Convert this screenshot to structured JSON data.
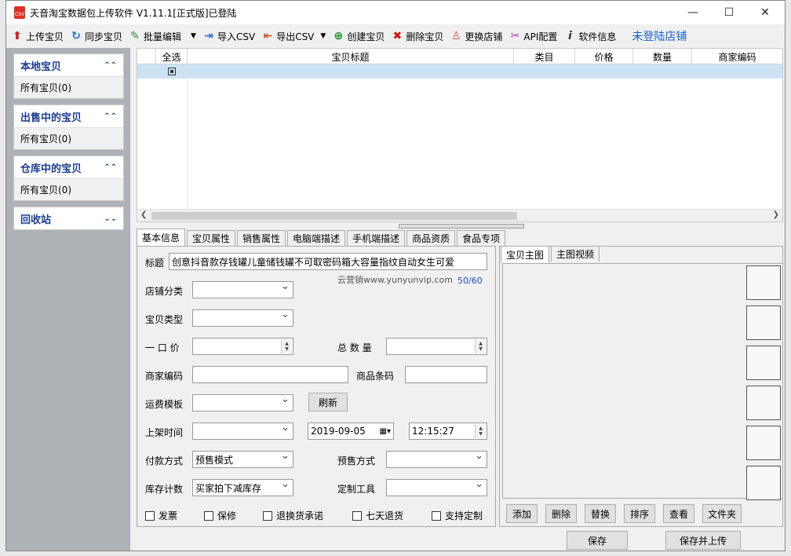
{
  "window": {
    "title": "天音淘宝数据包上传软件 V1.11.1[正式版]已登陆",
    "icon_text": "CSV",
    "min": "—",
    "max": "☐",
    "close": "✕"
  },
  "toolbar": {
    "upload": "上传宝贝",
    "sync": "同步宝贝",
    "batch_edit": "批量编辑",
    "import_csv": "导入CSV",
    "export_csv": "导出CSV",
    "create": "创建宝贝",
    "delete": "删除宝贝",
    "change_shop": "更换店铺",
    "api_config": "API配置",
    "software_info": "软件信息",
    "login_status": "未登陆店铺"
  },
  "sidebar": {
    "groups": [
      {
        "title": "本地宝贝",
        "item": "所有宝贝(0)"
      },
      {
        "title": "出售中的宝贝",
        "item": "所有宝贝(0)"
      },
      {
        "title": "仓库中的宝贝",
        "item": "所有宝贝(0)"
      },
      {
        "title": "回收站",
        "item": ""
      }
    ]
  },
  "grid": {
    "columns": [
      "全选",
      "宝贝标题",
      "类目",
      "价格",
      "数量",
      "商家编码"
    ]
  },
  "tabs": [
    "基本信息",
    "宝贝属性",
    "销售属性",
    "电脑端描述",
    "手机端描述",
    "商品资质",
    "食品专项"
  ],
  "form": {
    "title_label": "标题",
    "title_value": "创意抖音款存钱罐儿童储钱罐不可取密码箱大容量指纹自动女生可爱",
    "watermark": "云营销www.yunyunvip.com",
    "char_count": "50/60",
    "shop_category": "店铺分类",
    "item_type": "宝贝类型",
    "price": "一 口 价",
    "total_qty": "总 数 量",
    "merchant_code": "商家编码",
    "barcode": "商品条码",
    "freight": "运费模板",
    "refresh": "刷新",
    "list_time": "上架时间",
    "date_value": "2019-09-05",
    "time_value": "12:15:27",
    "payment": "付款方式",
    "payment_value": "预售模式",
    "presale": "预售方式",
    "stock_count": "库存计数",
    "stock_value": "买家拍下减库存",
    "custom_tool": "定制工具",
    "cb_invoice": "发票",
    "cb_warranty": "保修",
    "cb_return_promise": "退换货承诺",
    "cb_seven_day": "七天退货",
    "cb_custom": "支持定制"
  },
  "right": {
    "tab_main_image": "宝贝主图",
    "tab_main_video": "主图视频",
    "add": "添加",
    "delete": "删除",
    "replace": "替换",
    "sort": "排序",
    "view": "查看",
    "folder": "文件夹"
  },
  "bottom": {
    "save": "保存",
    "save_upload": "保存并上传"
  }
}
